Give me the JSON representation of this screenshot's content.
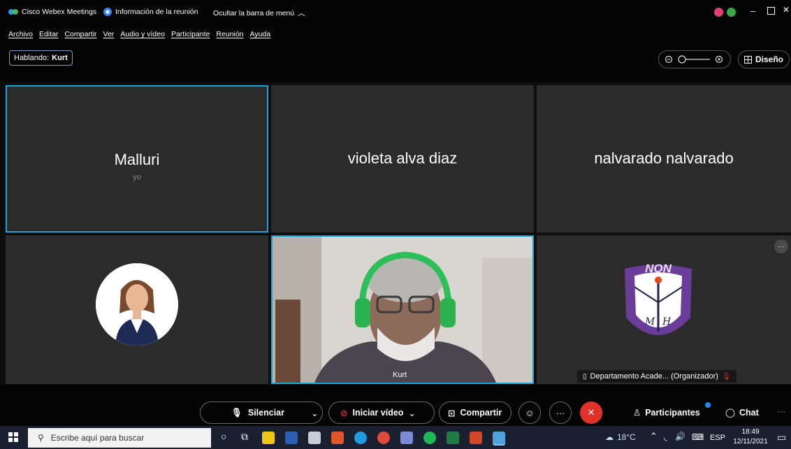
{
  "titlebar": {
    "app_title": "Cisco Webex Meetings",
    "meeting_info": "Información de la reunión",
    "hide_menu": "Ocultar la barra de menú"
  },
  "menu": [
    "Archivo",
    "Editar",
    "Compartir",
    "Ver",
    "Audio y vídeo",
    "Participante",
    "Reunión",
    "Ayuda"
  ],
  "toolbar": {
    "speaking_label": "Hablando:",
    "speaking_name": "Kurt",
    "layout_label": "Diseño"
  },
  "participants": {
    "tile1_name": "Malluri",
    "tile1_sub": "yo",
    "tile2_name": "violeta alva diaz",
    "tile3_name": "nalvarado nalvarado",
    "tile5_label": "Kurt",
    "tile6_label": "Departamento Acade... (Organizador)",
    "tile6_logo_text": "NON"
  },
  "controls": {
    "mute": "Silenciar",
    "video": "Iniciar vídeo",
    "share": "Compartir",
    "participants": "Participantes",
    "chat": "Chat"
  },
  "taskbar": {
    "search_placeholder": "Escribe aquí para buscar",
    "weather": "18°C",
    "lang": "ESP",
    "time": "18:49",
    "date": "12/11/2021"
  },
  "colors": {
    "active_border": "#1aa3d8",
    "end_call": "#e0312b",
    "notification_dot": "#1d8cf8"
  }
}
